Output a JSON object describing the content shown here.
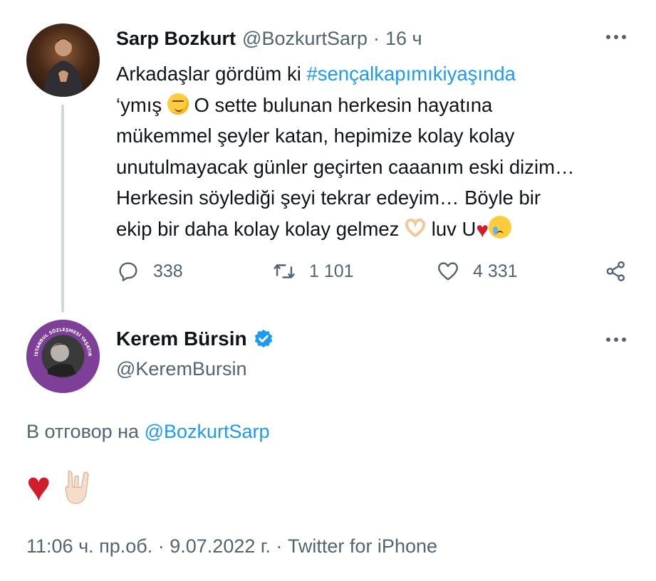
{
  "parent_tweet": {
    "display_name": "Sarp Bozkurt",
    "handle": "@BozkurtSarp",
    "separator": "·",
    "time": "16 ч",
    "text": {
      "line1_prefix": "Arkadaşlar gördüm ki ",
      "line1_hashtag": "#sençalkapımıkiyaşında",
      "line2_prefix": "‘ymış ",
      "line2_emoji": "smirking-face",
      "line2_suffix": " O sette bulunan herkesin hayatına",
      "line3": "mükemmel şeyler katan, hepimize kolay kolay",
      "line4": "unutulmayacak günler geçirten caaanım eski dizim…",
      "line5": "Herkesin söylediği şeyi tekrar edeyim… Böyle bir",
      "line6_prefix": "ekip bir daha kolay kolay gelmez ",
      "line6_emoji_1": "heart-hands",
      "line6_middle": " luv U",
      "line6_heart": "♥",
      "line6_emoji_2": "crying-face"
    },
    "actions": {
      "replies": "338",
      "retweets": "1 101",
      "likes": "4 331"
    },
    "icons": {
      "reply": "speech-bubble-icon",
      "retweet": "retweet-icon",
      "like": "heart-outline-icon",
      "share": "share-icon",
      "more": "more-dots-icon"
    }
  },
  "reply_tweet": {
    "display_name": "Kerem Bürsin",
    "verified": true,
    "handle": "@KeremBursin",
    "replying_prefix": "В отговор на",
    "replying_mention": "@BozkurtSarp",
    "body_heart": "♥",
    "body_emoji": "sign-of-the-horns",
    "avatar_ring_text": "İSTANBUL SÖZLEŞMESİ YAŞATIR",
    "timestamp": "11:06 ч. пр.об. · 9.07.2022 г. · Twitter for iPhone"
  },
  "colors": {
    "link": "#1d9bf0",
    "secondary_text": "#536471",
    "heart": "#d01c2b",
    "verified": "#1d9bf0",
    "avatar_ring": "#7d3f98"
  }
}
